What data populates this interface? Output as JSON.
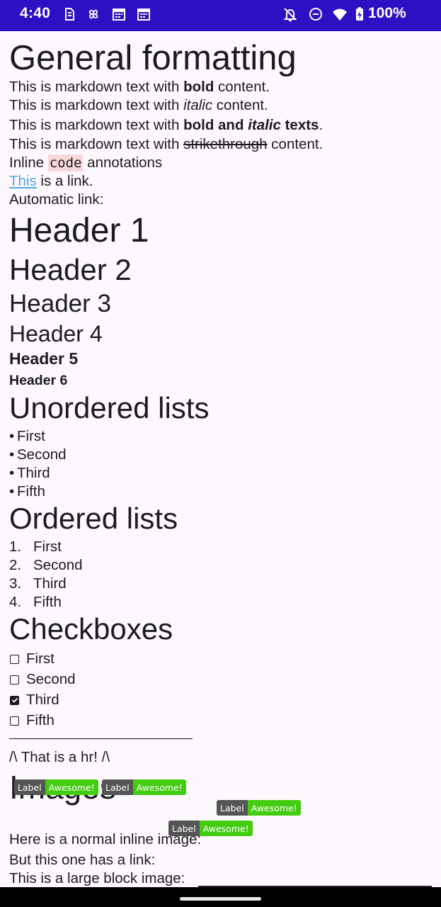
{
  "status_bar": {
    "time": "4:40",
    "battery_percent": "100%",
    "icons": [
      "sim-icon",
      "pinwheel-icon",
      "calendar-icon",
      "calendar-icon",
      "notifications-off-icon",
      "do-not-disturb-icon",
      "wifi-icon",
      "battery-charging-icon"
    ]
  },
  "document": {
    "title": "General formatting",
    "lines": {
      "bold_prefix": "This is markdown text with ",
      "bold_word": "bold",
      "bold_suffix": " content.",
      "italic_prefix": "This is markdown text with ",
      "italic_word": "italic",
      "italic_suffix": " content.",
      "bi_prefix": "This is markdown text with ",
      "bi_bold": "bold and ",
      "bi_italic": "italic",
      "bi_bold2": " texts",
      "bi_suffix": ".",
      "strike_prefix": "This is markdown text with ",
      "strike_word": "strikethrough",
      "strike_suffix": " content.",
      "code_prefix": "Inline ",
      "code_word": "code",
      "code_suffix": " annotations",
      "link_word": "This",
      "link_suffix": " is a link.",
      "auto_link": "Automatic link:"
    },
    "headers": [
      "Header 1",
      "Header 2",
      "Header 3",
      "Header 4",
      "Header 5",
      "Header 6"
    ],
    "unordered_title": "Unordered lists",
    "unordered_bullet": "•",
    "unordered_items": [
      "First",
      "Second",
      "Third",
      "Fifth"
    ],
    "ordered_title": "Ordered lists",
    "ordered_numbers": [
      "1.",
      "2.",
      "3.",
      "4."
    ],
    "ordered_items": [
      "First",
      "Second",
      "Third",
      "Fifth"
    ],
    "checkbox_title": "Checkboxes",
    "checkbox_items": [
      {
        "label": "First",
        "checked": false
      },
      {
        "label": "Second",
        "checked": false
      },
      {
        "label": "Third",
        "checked": true
      },
      {
        "label": "Fifth",
        "checked": false
      }
    ],
    "hr_caption": "/\\ That is a hr! /\\",
    "images_title": "Images",
    "badge": {
      "label": "Label",
      "value": "Awesome!",
      "label_color": "#555555",
      "value_color": "#44cc11"
    },
    "inline_image_text": "Here is a normal inline image:",
    "linked_image_text": "But this one has a link:",
    "block_image_text": "This is a large block image:"
  }
}
